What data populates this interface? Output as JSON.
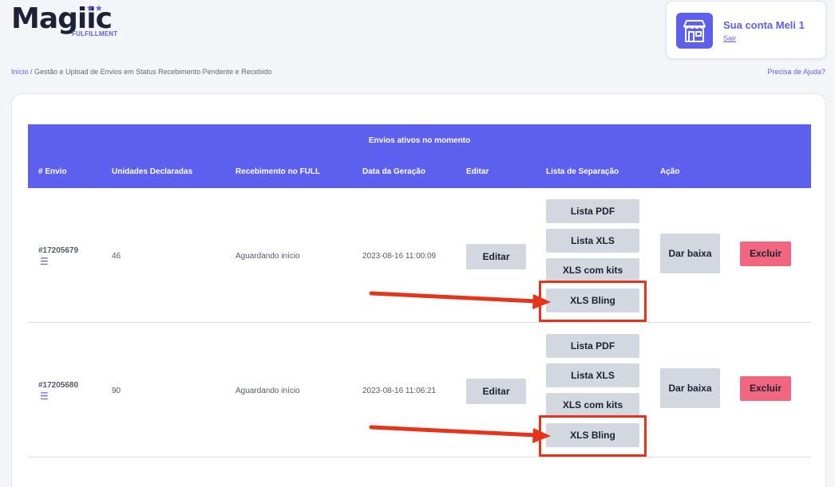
{
  "logo": {
    "word": "Magiic",
    "stars": "★★",
    "sub": "FULFILLMENT"
  },
  "account": {
    "name": "Sua conta Meli 1",
    "logout": "Sair",
    "icon": "store-icon"
  },
  "breadcrumb": {
    "home": "Início",
    "separator": " / ",
    "current": "Gestão e Upload de Envios em Status Recebimento Pendente e Recebido"
  },
  "help": "Precisa de Ajuda?",
  "table": {
    "title": "Envios ativos no momento",
    "columns": [
      "# Envio",
      "Unidades Declaradas",
      "Recebimento no FULL",
      "Data da Geração",
      "Editar",
      "Lista de Separação",
      "Ação"
    ],
    "rows": [
      {
        "id": "#17205679",
        "units": "46",
        "status": "Aguardando início",
        "date": "2023-08-16 11:00:09",
        "edit": "Editar",
        "lists": [
          "Lista PDF",
          "Lista XLS",
          "XLS com kits",
          "XLS Bling"
        ],
        "action": "Dar baixa",
        "delete": "Excluir"
      },
      {
        "id": "#17205680",
        "units": "90",
        "status": "Aguardando início",
        "date": "2023-08-16 11:06:21",
        "edit": "Editar",
        "lists": [
          "Lista PDF",
          "Lista XLS",
          "XLS com kits",
          "XLS Bling"
        ],
        "action": "Dar baixa",
        "delete": "Excluir"
      }
    ]
  },
  "colors": {
    "accent": "#5d5fef",
    "danger": "#f0677f",
    "annotation": "#e5341a",
    "button": "#d3d8e0"
  }
}
